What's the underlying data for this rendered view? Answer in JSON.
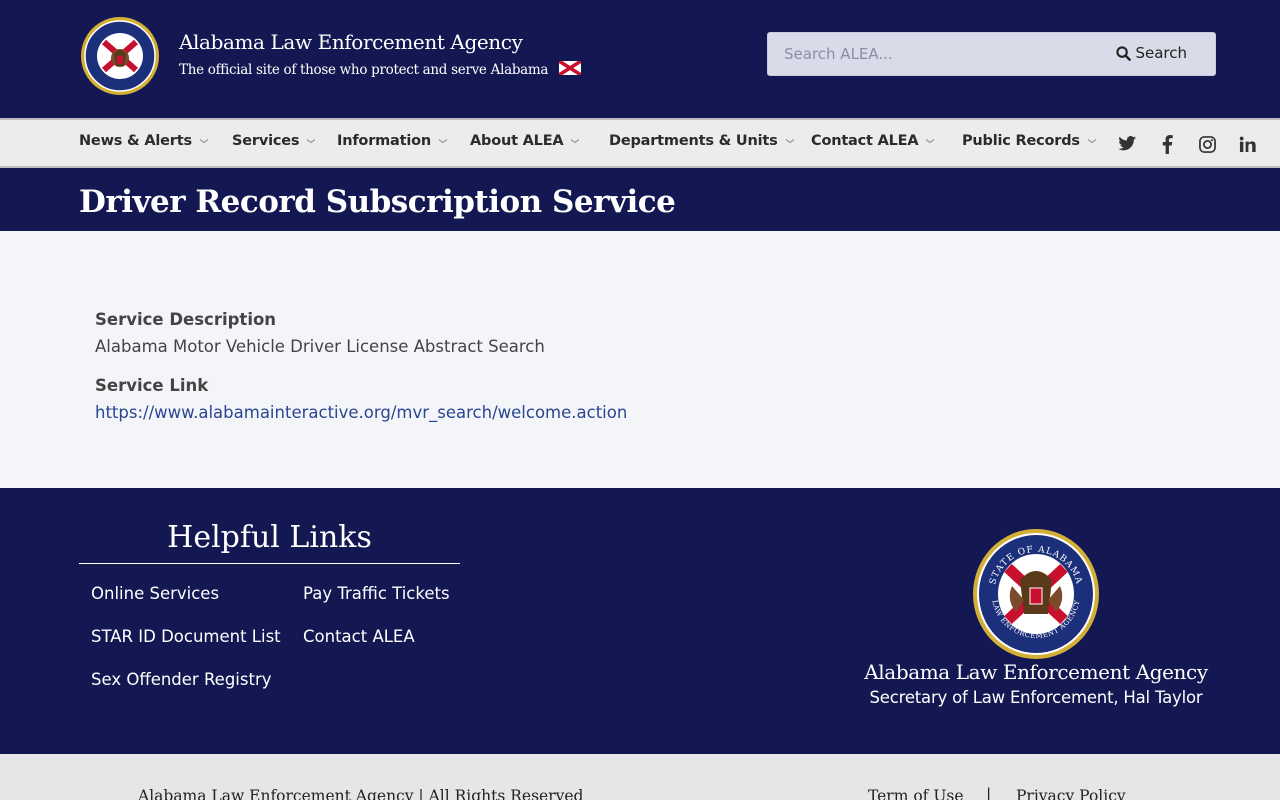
{
  "header": {
    "site_title": "Alabama Law Enforcement Agency",
    "tagline": "The official site of those who protect and serve Alabama",
    "logo_icon": "alea-seal-icon",
    "flag_icon": "alabama-flag-icon",
    "seal_text_top": "STATE OF ALABAMA",
    "seal_text_bottom": "LAW ENFORCEMENT AGENCY",
    "search": {
      "placeholder": "Search ALEA...",
      "button_label": "Search",
      "icon": "search-icon"
    }
  },
  "nav": {
    "items": [
      {
        "label": "News & Alerts"
      },
      {
        "label": "Services"
      },
      {
        "label": "Information"
      },
      {
        "label": "About ALEA"
      },
      {
        "label": "Departments & Units"
      },
      {
        "label": "Contact ALEA"
      },
      {
        "label": "Public Records"
      }
    ],
    "social": [
      "twitter-icon",
      "facebook-icon",
      "instagram-icon",
      "linkedin-icon"
    ]
  },
  "page": {
    "title": "Driver Record Subscription Service"
  },
  "main": {
    "description_label": "Service Description",
    "description_value": "Alabama Motor Vehicle Driver License Abstract Search",
    "link_label": "Service Link",
    "link_value": "https://www.alabamainteractive.org/mvr_search/welcome.action"
  },
  "footer": {
    "helpful_title": "Helpful Links",
    "links": [
      "Online Services",
      "Pay Traffic Tickets",
      "STAR ID Document List",
      "Contact ALEA",
      "Sex Offender Registry"
    ],
    "agency_name": "Alabama Law Enforcement Agency",
    "secretary": "Secretary of Law Enforcement, Hal Taylor"
  },
  "bottom": {
    "copyright": "Alabama Law Enforcement Agency | All Rights Reserved",
    "terms": "Term of Use",
    "separator": "|",
    "privacy": "Privacy Policy"
  },
  "colors": {
    "navy": "#131852",
    "nav_bg": "#ececec",
    "link_blue": "#2a4690",
    "seal_gold": "#c9a227",
    "seal_blue": "#1c2f7a",
    "flag_red": "#c8102e"
  }
}
